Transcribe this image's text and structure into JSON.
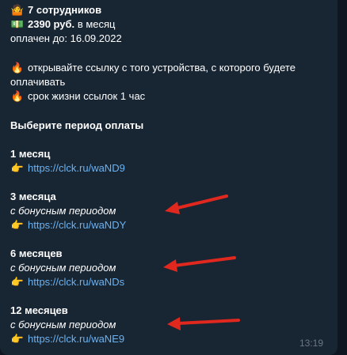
{
  "header": {
    "employees_emoji": "🤷",
    "employees": "7 сотрудников",
    "price_emoji": "💵",
    "price_amount": "2390 руб.",
    "price_period": "в месяц",
    "paid_until": "оплачен до: 16.09.2022"
  },
  "notes": [
    {
      "emoji": "🔥",
      "text": "открывайте ссылку с того устройства, с которого будете"
    },
    {
      "emoji": "",
      "text": "оплачивать"
    },
    {
      "emoji": "🔥",
      "text": "срок жизни ссылок 1 час"
    }
  ],
  "prompt": "Выберите период оплаты",
  "plans": [
    {
      "title": "1 месяц",
      "bonus": "",
      "pointer": "👉",
      "link": "https://clck.ru/waND9"
    },
    {
      "title": "3 месяца",
      "bonus": "с бонусным периодом",
      "pointer": "👉",
      "link": "https://clck.ru/waNDY"
    },
    {
      "title": "6 месяцев",
      "bonus": "с бонусным периодом",
      "pointer": "👉",
      "link": "https://clck.ru/waNDs"
    },
    {
      "title": "12 месяцев",
      "bonus": "с бонусным периодом",
      "pointer": "👉",
      "link": "https://clck.ru/waNE9"
    }
  ],
  "time": "13:19",
  "colors": {
    "background": "#0e1621",
    "bubble": "#182533",
    "link": "#6ab3f3",
    "arrow": "#e0281e",
    "timestamp": "#6c7883"
  }
}
